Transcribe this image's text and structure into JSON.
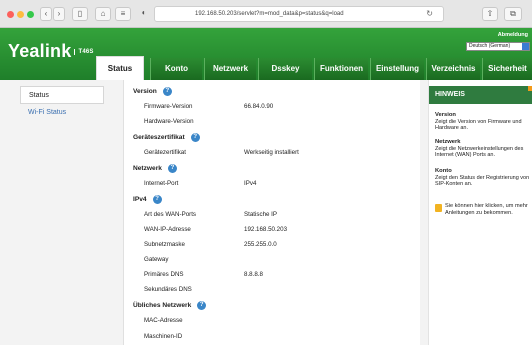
{
  "browser": {
    "url": "192.168.50.203/servlet?m=mod_data&p=status&q=load",
    "nav_back": "‹",
    "nav_forward": "›",
    "reload": "↻"
  },
  "header": {
    "brand": "Yealink",
    "model": "T46S",
    "logout": "Abmeldung",
    "language": "Deutsch (German)"
  },
  "tabs": [
    "Status",
    "Konto",
    "Netzwerk",
    "Dsskey",
    "Funktionen",
    "Einstellung",
    "Verzeichnis",
    "Sicherheit"
  ],
  "sidebar": {
    "items": [
      {
        "label": "Status"
      },
      {
        "label": "Wi-Fi Status"
      }
    ]
  },
  "main": {
    "rows": [
      {
        "type": "section",
        "label": "Version",
        "help": true
      },
      {
        "type": "field",
        "label": "Firmware-Version",
        "value": "66.84.0.90"
      },
      {
        "type": "field",
        "label": "Hardware-Version",
        "value": ""
      },
      {
        "type": "section",
        "label": "Geräteszertifikat",
        "help": true
      },
      {
        "type": "field",
        "label": "Gerätezertifikat",
        "value": "Werkseitig installiert"
      },
      {
        "type": "section",
        "label": "Netzwerk",
        "help": true
      },
      {
        "type": "field",
        "label": "Internet-Port",
        "value": "IPv4"
      },
      {
        "type": "section",
        "label": "IPv4",
        "help": true
      },
      {
        "type": "field",
        "label": "Art des WAN-Ports",
        "value": "Statische IP"
      },
      {
        "type": "field",
        "label": "WAN-IP-Adresse",
        "value": "192.168.50.203"
      },
      {
        "type": "field",
        "label": "Subnetzmaske",
        "value": "255.255.0.0"
      },
      {
        "type": "field",
        "label": "Gateway",
        "value": ""
      },
      {
        "type": "field",
        "label": "Primäres DNS",
        "value": "8.8.8.8"
      },
      {
        "type": "field",
        "label": "Sekundäres DNS",
        "value": ""
      },
      {
        "type": "section",
        "label": "Übliches Netzwerk",
        "help": true
      },
      {
        "type": "field",
        "label": "MAC-Adresse",
        "value": ""
      },
      {
        "type": "field",
        "label": "Maschinen-ID",
        "value": ""
      }
    ]
  },
  "hints": {
    "title": "HINWEIS",
    "notes": [
      {
        "heading": "Version",
        "text": "Zeigt die Version von Firmware und Hardware an."
      },
      {
        "heading": "Netzwerk",
        "text": "Zeigt die Netzwerkeinstellungen des Internet (WAN) Ports an."
      },
      {
        "heading": "Konto",
        "text": "Zeigt den Status der Registrierung von SIP-Konten an."
      }
    ],
    "tip": "Sie können hier klicken, um mehr Anleitungen zu bekommen."
  },
  "colors": {
    "brand_green": "#2a9231",
    "hint_header": "#2f7b3f",
    "link_blue": "#3a6fb0",
    "help_icon": "#3a86c8"
  }
}
